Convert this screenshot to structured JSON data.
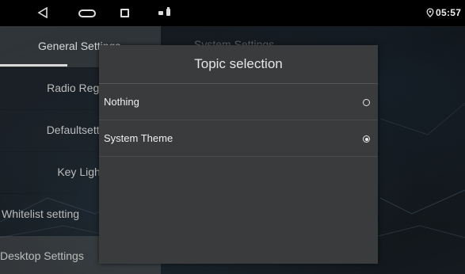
{
  "status_bar": {
    "time": "05:57",
    "icons": [
      "back-icon",
      "home-icon",
      "recent-apps-icon",
      "notification-icon",
      "battery-icon",
      "location-icon"
    ]
  },
  "menu": {
    "items": [
      {
        "label": "General Settings",
        "active": true
      },
      {
        "label": "Radio Region"
      },
      {
        "label": "Defaultsetting"
      },
      {
        "label": "Key Light"
      },
      {
        "label": "Whitelist setting"
      },
      {
        "label": "Desktop Settings"
      }
    ]
  },
  "right_tab": {
    "label": "System Settings"
  },
  "dialog": {
    "title": "Topic selection",
    "options": [
      {
        "label": "Nothing",
        "selected": false
      },
      {
        "label": "System Theme",
        "selected": true
      }
    ]
  },
  "colors": {
    "dialog_bg": "#3a3b3d",
    "menu_active": "#464a4e",
    "status_bar": "#000000"
  }
}
